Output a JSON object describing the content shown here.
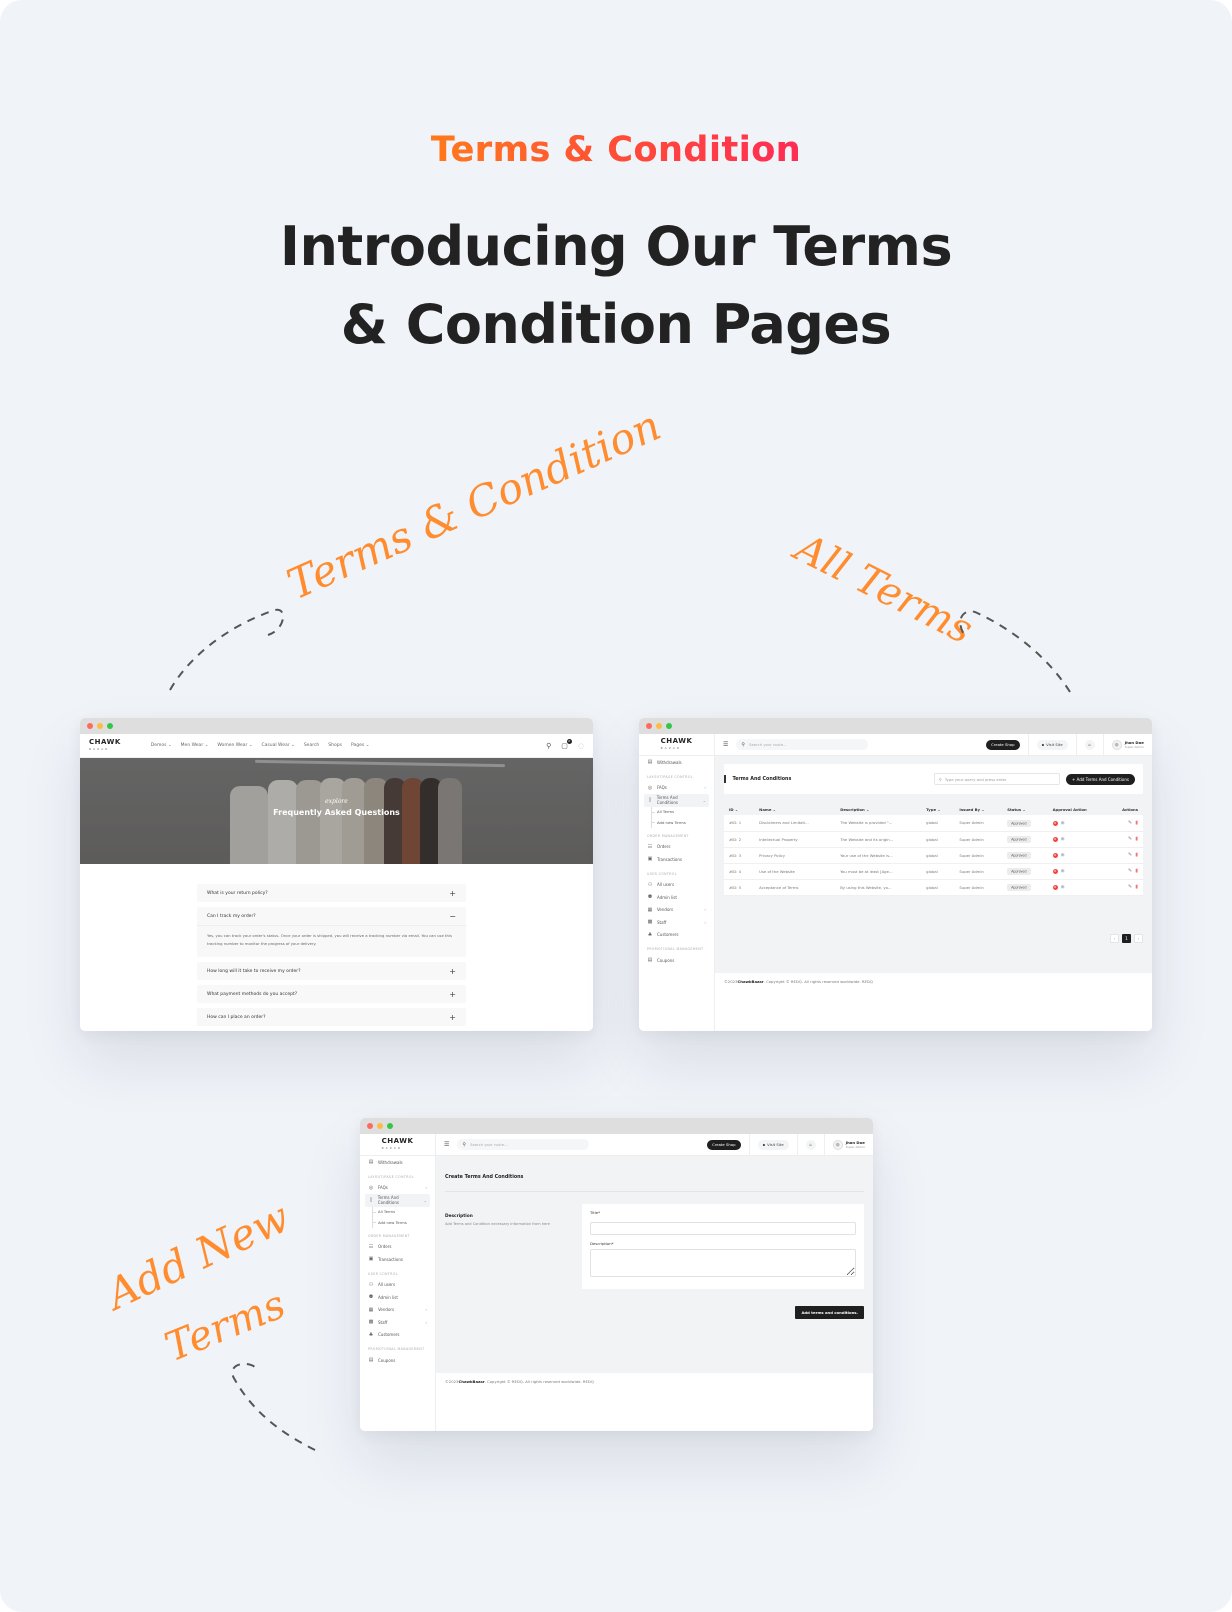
{
  "header": {
    "eyebrow": "Terms & Condition",
    "headline_line1": "Introducing Our Terms",
    "headline_line2": "& Condition Pages"
  },
  "colors": {
    "accent_gradient_start": "#ff7a1a",
    "accent_gradient_end": "#ff2b55",
    "handwriting": "#ff8c2e",
    "dark_button": "#1f1f1f",
    "background": "#f0f3f8"
  },
  "annotations": {
    "terms_condition": "Terms & Condition",
    "all_terms": "All Terms",
    "add_new_line1": "Add New",
    "add_new_line2": "Terms"
  },
  "storefront": {
    "logo": "CHAWK",
    "logo_sub": "BAZAR",
    "nav": [
      "Demos ⌄",
      "Men Wear ⌄",
      "Women Wear ⌄",
      "Casual Wear ⌄",
      "Search",
      "Shops",
      "Pages ⌄"
    ],
    "cart_count": "0",
    "hero_script": "explore",
    "hero_title": "Frequently Asked Questions",
    "faqs": [
      {
        "q": "What is your return policy?",
        "icon": "+",
        "open": false
      },
      {
        "q": "Can I track my order?",
        "icon": "−",
        "open": true,
        "a": "Yes, you can track your order's status. Once your order is shipped, you will receive a tracking number via email. You can use this tracking number to monitor the progress of your delivery."
      },
      {
        "q": "How long will it take to receive my order?",
        "icon": "+",
        "open": false
      },
      {
        "q": "What payment methods do you accept?",
        "icon": "+",
        "open": false
      },
      {
        "q": "How can I place an order?",
        "icon": "+",
        "open": false
      }
    ]
  },
  "admin": {
    "logo": "CHAWK",
    "logo_sub": "BAZAR",
    "search_placeholder": "Search your route...",
    "create_shop": "Create Shop",
    "visit_site": "Visit Site",
    "user_name": "Jhon Doe",
    "user_role": "Super Admin",
    "sidebar": [
      {
        "type": "item",
        "label": "Withdrawals",
        "icon": "▤"
      },
      {
        "type": "section",
        "label": "Layout/Page Control"
      },
      {
        "type": "item",
        "label": "FAQs",
        "icon": "◎",
        "chevron": "›"
      },
      {
        "type": "item",
        "label": "Terms And Conditions",
        "icon": "▯",
        "chevron": "⌄",
        "active": true
      },
      {
        "type": "sub",
        "label": "All Terms"
      },
      {
        "type": "sub",
        "label": "Add new Terms"
      },
      {
        "type": "section",
        "label": "Order Management"
      },
      {
        "type": "item",
        "label": "Orders",
        "icon": "☷"
      },
      {
        "type": "item",
        "label": "Transactions",
        "icon": "▣"
      },
      {
        "type": "section",
        "label": "User Control"
      },
      {
        "type": "item",
        "label": "All users",
        "icon": "⚇"
      },
      {
        "type": "item",
        "label": "Admin list",
        "icon": "⚉"
      },
      {
        "type": "item",
        "label": "Vendors",
        "icon": "▦",
        "chevron": "›"
      },
      {
        "type": "item",
        "label": "Staff",
        "icon": "▩",
        "chevron": "›"
      },
      {
        "type": "item",
        "label": "Customers",
        "icon": "♣"
      },
      {
        "type": "section",
        "label": "Promotional Management"
      },
      {
        "type": "item",
        "label": "Coupons",
        "icon": "▤"
      }
    ],
    "footer_prefix": "©2023 ",
    "footer_brand": "ChawkBazar",
    "footer_rest": ". Copyright © REDQ. All rights reserved worldwide. REDQ"
  },
  "all_terms": {
    "title": "Terms And Conditions",
    "search_placeholder": "Type your query and press enter",
    "add_button": "+ Add Terms And Conditions",
    "columns": [
      "ID ⌄",
      "Name ⌄",
      "Description ⌄",
      "Type ⌄",
      "Issued By ⌄",
      "Status ⌄",
      "Approval Action",
      "Actions"
    ],
    "rows": [
      {
        "id": "#ID: 1",
        "name": "Disclaimers and Limitati...",
        "desc": "The Website is provided \"...",
        "type": "global",
        "issued_by": "Super Admin",
        "status": "Approved"
      },
      {
        "id": "#ID: 2",
        "name": "Intellectual Property",
        "desc": "The Website and its origin...",
        "type": "global",
        "issued_by": "Super Admin",
        "status": "Approved"
      },
      {
        "id": "#ID: 3",
        "name": "Privacy Policy",
        "desc": "Your use of the Website is...",
        "type": "global",
        "issued_by": "Super Admin",
        "status": "Approved"
      },
      {
        "id": "#ID: 4",
        "name": "Use of the Website",
        "desc": "You must be at least [Age...",
        "type": "global",
        "issued_by": "Super Admin",
        "status": "Approved"
      },
      {
        "id": "#ID: 5",
        "name": "Acceptance of Terms",
        "desc": "By using this Website, yo...",
        "type": "global",
        "issued_by": "Super Admin",
        "status": "Approved"
      }
    ],
    "pagination": {
      "prev": "‹",
      "current": "1",
      "next": "›"
    }
  },
  "create_terms": {
    "title": "Create Terms And Conditions",
    "section_title": "Description",
    "section_desc": "Add Terms and Condition necessary information from here",
    "title_label": "Title*",
    "description_label": "Description*",
    "title_value": "",
    "description_value": "",
    "submit": "Add terms and conditions."
  }
}
